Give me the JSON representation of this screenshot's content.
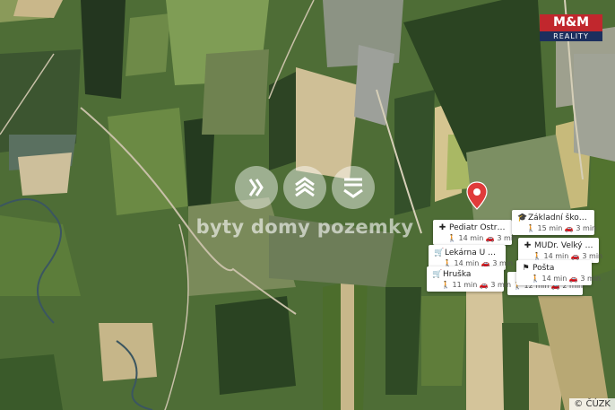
{
  "logo": {
    "brand": "M&M",
    "sub": "REALITY"
  },
  "watermark": {
    "text": "byty domy pozemky"
  },
  "pin": {
    "icon": "location-pin-icon",
    "color": "#e03b3b"
  },
  "pois": [
    {
      "icon": "hospital-icon",
      "name": "Pediatr Ostrava - ...",
      "walk": "14 min",
      "drive": "3 min"
    },
    {
      "icon": "school-icon",
      "name": "Základní škola Os...",
      "walk": "15 min",
      "drive": "3 min"
    },
    {
      "icon": "pharmacy-icon",
      "name": "Lekárna U Svatéh...",
      "walk": "14 min",
      "drive": "3 min"
    },
    {
      "icon": "hospital-icon",
      "name": "MUDr. Velký Oldři...",
      "walk": "14 min",
      "drive": "3 min"
    },
    {
      "icon": "post-office-icon",
      "name": "Pošta",
      "walk": "14 min",
      "drive": "3 min"
    },
    {
      "icon": "shop-icon",
      "name": "Hruška",
      "walk": "11 min",
      "drive": "3 min"
    },
    {
      "icon": "school-icon",
      "name": "",
      "walk": "12 min",
      "drive": "2 min"
    }
  ],
  "copyright": "© ČÚZK"
}
